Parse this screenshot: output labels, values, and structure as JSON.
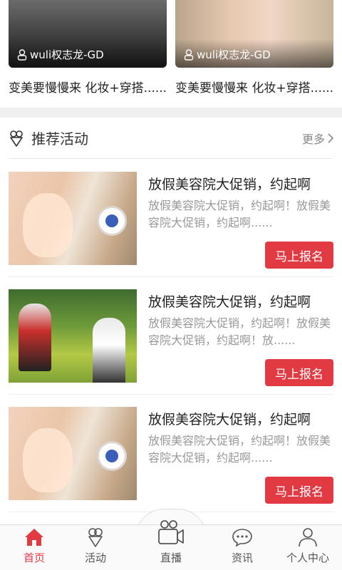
{
  "top_cards": [
    {
      "author": "wuli权志龙-GD",
      "title": "变美要慢慢来 化妆+穿搭......"
    },
    {
      "author": "wuli权志龙-GD",
      "title": "变美要慢慢来 化妆+穿搭......"
    }
  ],
  "section": {
    "title": "推荐活动",
    "more": "更多",
    "icon": "ice-cream-icon"
  },
  "activities": [
    {
      "title": "放假美容院大促销，约起啊",
      "desc": "放假美容院大促销，约起啊！放假美容院大促销，约起啊......",
      "button": "马上报名",
      "image": "spa-facial"
    },
    {
      "title": "放假美容院大促销，约起啊",
      "desc": "放假美容院大促销，约起啊！放假美容院大促销，约起啊！放......",
      "button": "马上报名",
      "image": "cycling"
    },
    {
      "title": "放假美容院大促销，约起啊",
      "desc": "放假美容院大促销，约起啊！放假美容院大促销，约起啊......",
      "button": "马上报名",
      "image": "spa-facial"
    }
  ],
  "tabbar": {
    "items": [
      {
        "label": "首页",
        "icon": "home-icon",
        "active": true
      },
      {
        "label": "活动",
        "icon": "ice-cream-icon"
      },
      {
        "label": "直播",
        "icon": "video-camera-icon"
      },
      {
        "label": "资讯",
        "icon": "chat-bubble-icon"
      },
      {
        "label": "个人中心",
        "icon": "person-icon"
      }
    ]
  },
  "colors": {
    "accent": "#e23a43",
    "text": "#222222",
    "muted": "#999999"
  }
}
